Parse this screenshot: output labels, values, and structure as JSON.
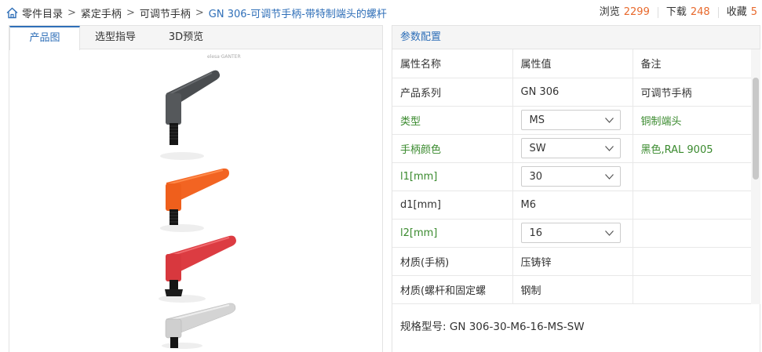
{
  "breadcrumb": {
    "items": [
      "零件目录",
      "紧定手柄",
      "可调节手柄"
    ],
    "current": "GN 306-可调节手柄-带特制端头的螺杆",
    "separator": ">"
  },
  "stats": {
    "views_label": "浏览",
    "views": "2299",
    "downloads_label": "下载",
    "downloads": "248",
    "favorites_label": "收藏",
    "favorites": "5"
  },
  "tabs": [
    "产品图",
    "选型指导",
    "3D预览"
  ],
  "left": {
    "watermark": "elesa·GANTER"
  },
  "params": {
    "header": "参数配置",
    "columns": [
      "属性名称",
      "属性值",
      "备注"
    ],
    "rows": [
      {
        "name": "产品系列",
        "value": "GN 306",
        "note": "可调节手柄"
      },
      {
        "name": "类型",
        "value": "MS",
        "note": "铜制端头"
      },
      {
        "name": "手柄颜色",
        "value": "SW",
        "note": "黑色,RAL 9005"
      },
      {
        "name": "l1[mm]",
        "value": "30",
        "note": ""
      },
      {
        "name": "d1[mm]",
        "value": "M6",
        "note": ""
      },
      {
        "name": "l2[mm]",
        "value": "16",
        "note": ""
      },
      {
        "name": "材质(手柄)",
        "value": "压铸锌",
        "note": ""
      },
      {
        "name": "材质(螺杆和固定螺",
        "value": "钢制",
        "note": ""
      }
    ],
    "spec_label": "规格型号:",
    "spec_value": "GN 306-30-M6-16-MS-SW"
  },
  "colors": {
    "accent": "#2f6fb8",
    "count": "#e8692c",
    "editable": "#3a8a2e"
  },
  "icons": {
    "home": "home-icon",
    "dropdown": "chevron-down-icon"
  },
  "product_variants": [
    "black",
    "orange",
    "red",
    "silver"
  ]
}
